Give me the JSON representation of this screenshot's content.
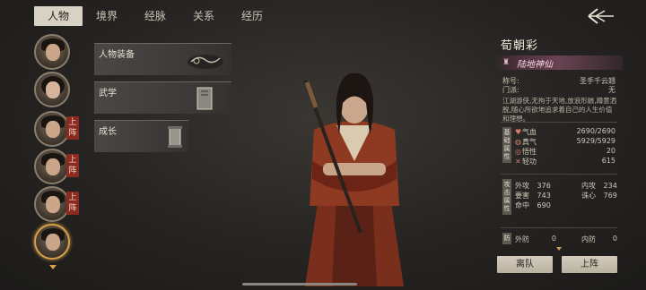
{
  "tabs": [
    {
      "label": "人物",
      "active": true
    },
    {
      "label": "境界",
      "active": false
    },
    {
      "label": "经脉",
      "active": false
    },
    {
      "label": "关系",
      "active": false
    },
    {
      "label": "经历",
      "active": false
    }
  ],
  "portraits": [
    {
      "badge": ""
    },
    {
      "badge": ""
    },
    {
      "badge": "上阵"
    },
    {
      "badge": "上阵"
    },
    {
      "badge": "上阵"
    },
    {
      "badge": ""
    }
  ],
  "cards": [
    {
      "label": "人物装备"
    },
    {
      "label": "武学"
    },
    {
      "label": "成长"
    }
  ],
  "character": {
    "name": "荀朝彩",
    "rank": "陆地神仙",
    "title_label": "称号:",
    "title_value": "圣手千云翘",
    "sect_label": "门派:",
    "sect_value": "无",
    "description": "江湖游侠,无拘于天地,放浪形骸,蹲意洒脱,随心所欲地追求着自己的人生价值和理想。"
  },
  "base_attrs": {
    "tag": "基础属性",
    "items": [
      {
        "icon": "♥",
        "name": "气血",
        "value": "2690/2690"
      },
      {
        "icon": "◍",
        "name": "真气",
        "value": "5929/5929"
      },
      {
        "icon": "◎",
        "name": "悟性",
        "value": "20"
      },
      {
        "icon": "✕",
        "name": "轻功",
        "value": "615"
      }
    ]
  },
  "attack_attrs": {
    "tag": "攻击属性",
    "items": [
      {
        "name": "外攻",
        "value": "376"
      },
      {
        "name": "内攻",
        "value": "234"
      },
      {
        "name": "要害",
        "value": "743"
      },
      {
        "name": "诛心",
        "value": "769"
      },
      {
        "name": "命中",
        "value": "690"
      }
    ]
  },
  "defense_attrs": {
    "tag": "防",
    "items": [
      {
        "name": "外防",
        "value": "0"
      },
      {
        "name": "内防",
        "value": "0"
      }
    ]
  },
  "buttons": {
    "leave": "离队",
    "deploy": "上阵"
  }
}
